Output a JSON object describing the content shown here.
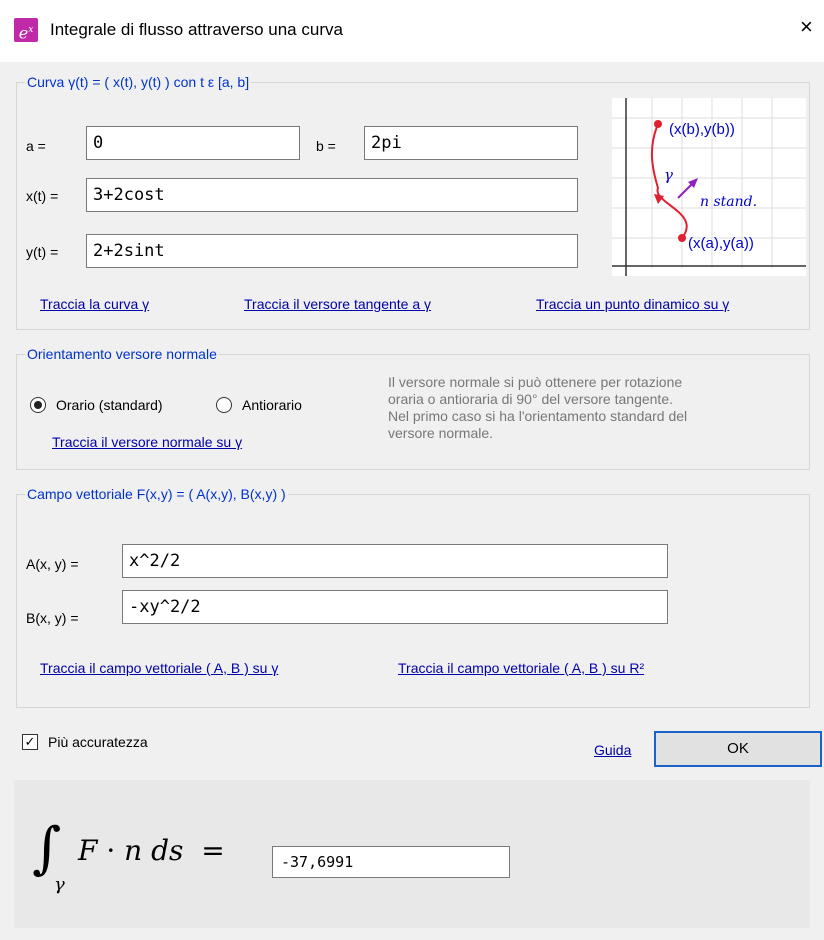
{
  "window": {
    "title": "Integrale di flusso attraverso una curva",
    "close": "×",
    "icon_text": "e",
    "icon_sup": "x",
    "accent": "#c02aa8"
  },
  "curve": {
    "legend": "Curva γ(t) = ( x(t),  y(t) ) con t ε [a, b]",
    "a_label": "a =",
    "a_value": "0",
    "b_label": "b =",
    "b_value": "2pi",
    "x_label": "x(t) =",
    "x_value": "3+2cost",
    "y_label": "y(t) =",
    "y_value": "2+2sint",
    "diagram": {
      "end_label": "(x(b),y(b))",
      "start_label": "(x(a),y(a))",
      "gamma": "γ",
      "n_label": "n",
      "n_suffix": " stand."
    },
    "links": {
      "draw_curve": "Traccia la curva γ",
      "draw_tangent": "Traccia il versore tangente a γ",
      "draw_point": "Traccia un punto dinamico su γ"
    }
  },
  "orientation": {
    "legend": "Orientamento versore normale",
    "clockwise": "Orario (standard)",
    "counterclockwise": "Antiorario",
    "selected": "clockwise",
    "link": "Traccia il versore normale su γ",
    "help_lines": [
      "Il versore normale si può ottenere per rotazione",
      "oraria o antioraria di  90° del versore tangente.",
      "Nel primo caso si ha l'orientamento standard del",
      "versore normale."
    ]
  },
  "field": {
    "legend": "Campo vettoriale F(x,y) = ( A(x,y), B(x,y) )",
    "a_label": "A(x, y) =",
    "a_value": "x^2/2",
    "b_label": "B(x, y) =",
    "b_value": "-xy^2/2",
    "link_curve": "Traccia il campo vettoriale ( A, B ) su γ",
    "link_plane": "Traccia il campo vettoriale ( A, B ) su R²"
  },
  "accuracy": {
    "label": "Più accuratezza",
    "checked": true
  },
  "help_link": "Guida",
  "ok": "OK",
  "result": {
    "value": "-37,6991",
    "formula_F": "F",
    "formula_n": "n",
    "formula_ds": "ds",
    "equals": "=",
    "integral": "∫",
    "gamma": "γ",
    "dot": "·"
  }
}
